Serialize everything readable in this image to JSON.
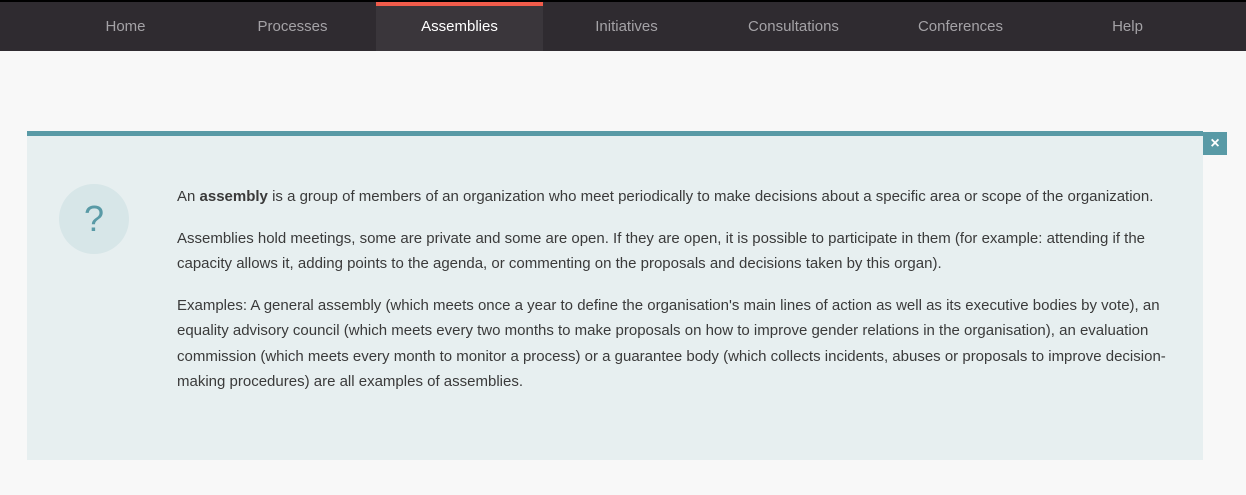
{
  "nav": {
    "items": [
      {
        "label": "Home",
        "active": false
      },
      {
        "label": "Processes",
        "active": false
      },
      {
        "label": "Assemblies",
        "active": true
      },
      {
        "label": "Initiatives",
        "active": false
      },
      {
        "label": "Consultations",
        "active": false
      },
      {
        "label": "Conferences",
        "active": false
      },
      {
        "label": "Help",
        "active": false
      }
    ]
  },
  "help_panel": {
    "close_label": "×",
    "icon_glyph": "?",
    "icon_name": "question-icon",
    "paragraph1": {
      "prefix": "An ",
      "bold": "assembly",
      "suffix": " is a group of members of an organization who meet periodically to make decisions about a specific area or scope of the organization."
    },
    "paragraph2": "Assemblies hold meetings, some are private and some are open. If they are open, it is possible to participate in them (for example: attending if the capacity allows it, adding points to the agenda, or commenting on the proposals and decisions taken by this organ).",
    "paragraph3": "Examples: A general assembly (which meets once a year to define the organisation's main lines of action as well as its executive bodies by vote), an equality advisory council (which meets every two months to make proposals on how to improve gender relations in the organisation), an evaluation commission (which meets every month to monitor a process) or a guarantee body (which collects incidents, abuses or proposals to improve decision-making procedures) are all examples of assemblies."
  },
  "colors": {
    "topbar_bg": "#2f2b30",
    "active_accent": "#f15c4b",
    "panel_accent": "#599aa6",
    "panel_bg": "#e7eff0",
    "page_bg": "#f8f8f8"
  }
}
